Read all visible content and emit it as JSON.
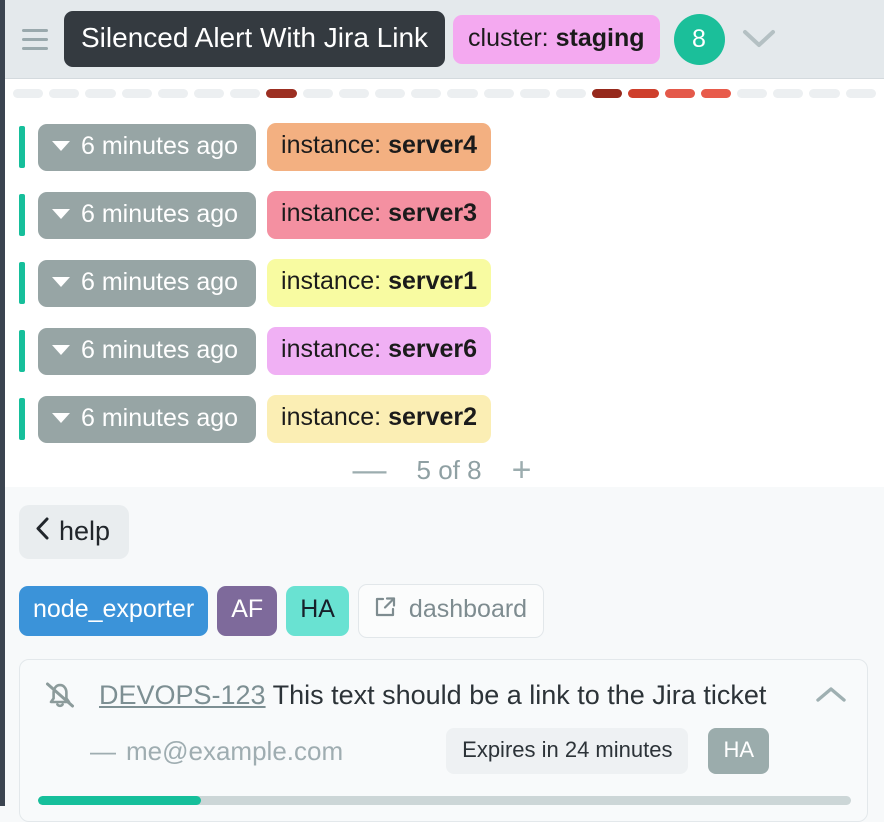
{
  "header": {
    "menu_icon": "hamburger-icon",
    "title": "Silenced Alert With Jira Link",
    "cluster_key": "cluster:",
    "cluster_value": "staging",
    "count": "8",
    "expand_icon": "chevron-down-icon"
  },
  "segments": {
    "count": 24,
    "default_color": "#eceff1",
    "overrides": [
      {
        "index": 7,
        "color": "#9c2f22"
      },
      {
        "index": 16,
        "color": "#96291c"
      },
      {
        "index": 17,
        "color": "#ce3f2c"
      },
      {
        "index": 18,
        "color": "#e4594a"
      },
      {
        "index": 19,
        "color": "#e85b4b"
      }
    ]
  },
  "alerts": {
    "accent_color": "#16bf9b",
    "rows": [
      {
        "time": "6 minutes ago",
        "label_key": "instance:",
        "label_value": "server4",
        "chip_bg": "#f3b081",
        "caret_icon": "caret-down-icon"
      },
      {
        "time": "6 minutes ago",
        "label_key": "instance:",
        "label_value": "server3",
        "chip_bg": "#f490a1",
        "caret_icon": "caret-down-icon"
      },
      {
        "time": "6 minutes ago",
        "label_key": "instance:",
        "label_value": "server1",
        "chip_bg": "#f8fba1",
        "caret_icon": "caret-down-icon"
      },
      {
        "time": "6 minutes ago",
        "label_key": "instance:",
        "label_value": "server6",
        "chip_bg": "#f0b0f4",
        "caret_icon": "caret-down-icon"
      },
      {
        "time": "6 minutes ago",
        "label_key": "instance:",
        "label_value": "server2",
        "chip_bg": "#fbeeb4",
        "caret_icon": "caret-down-icon"
      }
    ]
  },
  "pager": {
    "decrease_label": "—",
    "status": "5 of 8",
    "increase_label": "+"
  },
  "detail": {
    "back_icon": "chevron-left-icon",
    "back_label": "help",
    "tags": [
      {
        "label": "node_exporter",
        "style": "blue"
      },
      {
        "label": "AF",
        "style": "purple"
      },
      {
        "label": "HA",
        "style": "teal"
      },
      {
        "label": "dashboard",
        "style": "ghost",
        "icon": "external-link-icon"
      }
    ],
    "silence": {
      "bell_icon": "bell-slash-icon",
      "ticket_id": "DEVOPS-123",
      "description": "This text should be a link to the Jira ticket",
      "collapse_icon": "chevron-up-icon",
      "owner_dash": "—",
      "owner": "me@example.com",
      "expires": "Expires in 24 minutes",
      "ha_badge": "HA",
      "progress_percent": 20
    }
  },
  "colors": {
    "accent_teal": "#16bf9b",
    "header_bg": "#e4e9ec",
    "title_bg": "#343a40",
    "cluster_bg": "#f4a9f0",
    "time_chip_bg": "#97a5a5",
    "tag_blue": "#3b93d9",
    "tag_purple": "#7e6a9b",
    "tag_teal": "#69e2d2",
    "rail": "#3b4450"
  }
}
